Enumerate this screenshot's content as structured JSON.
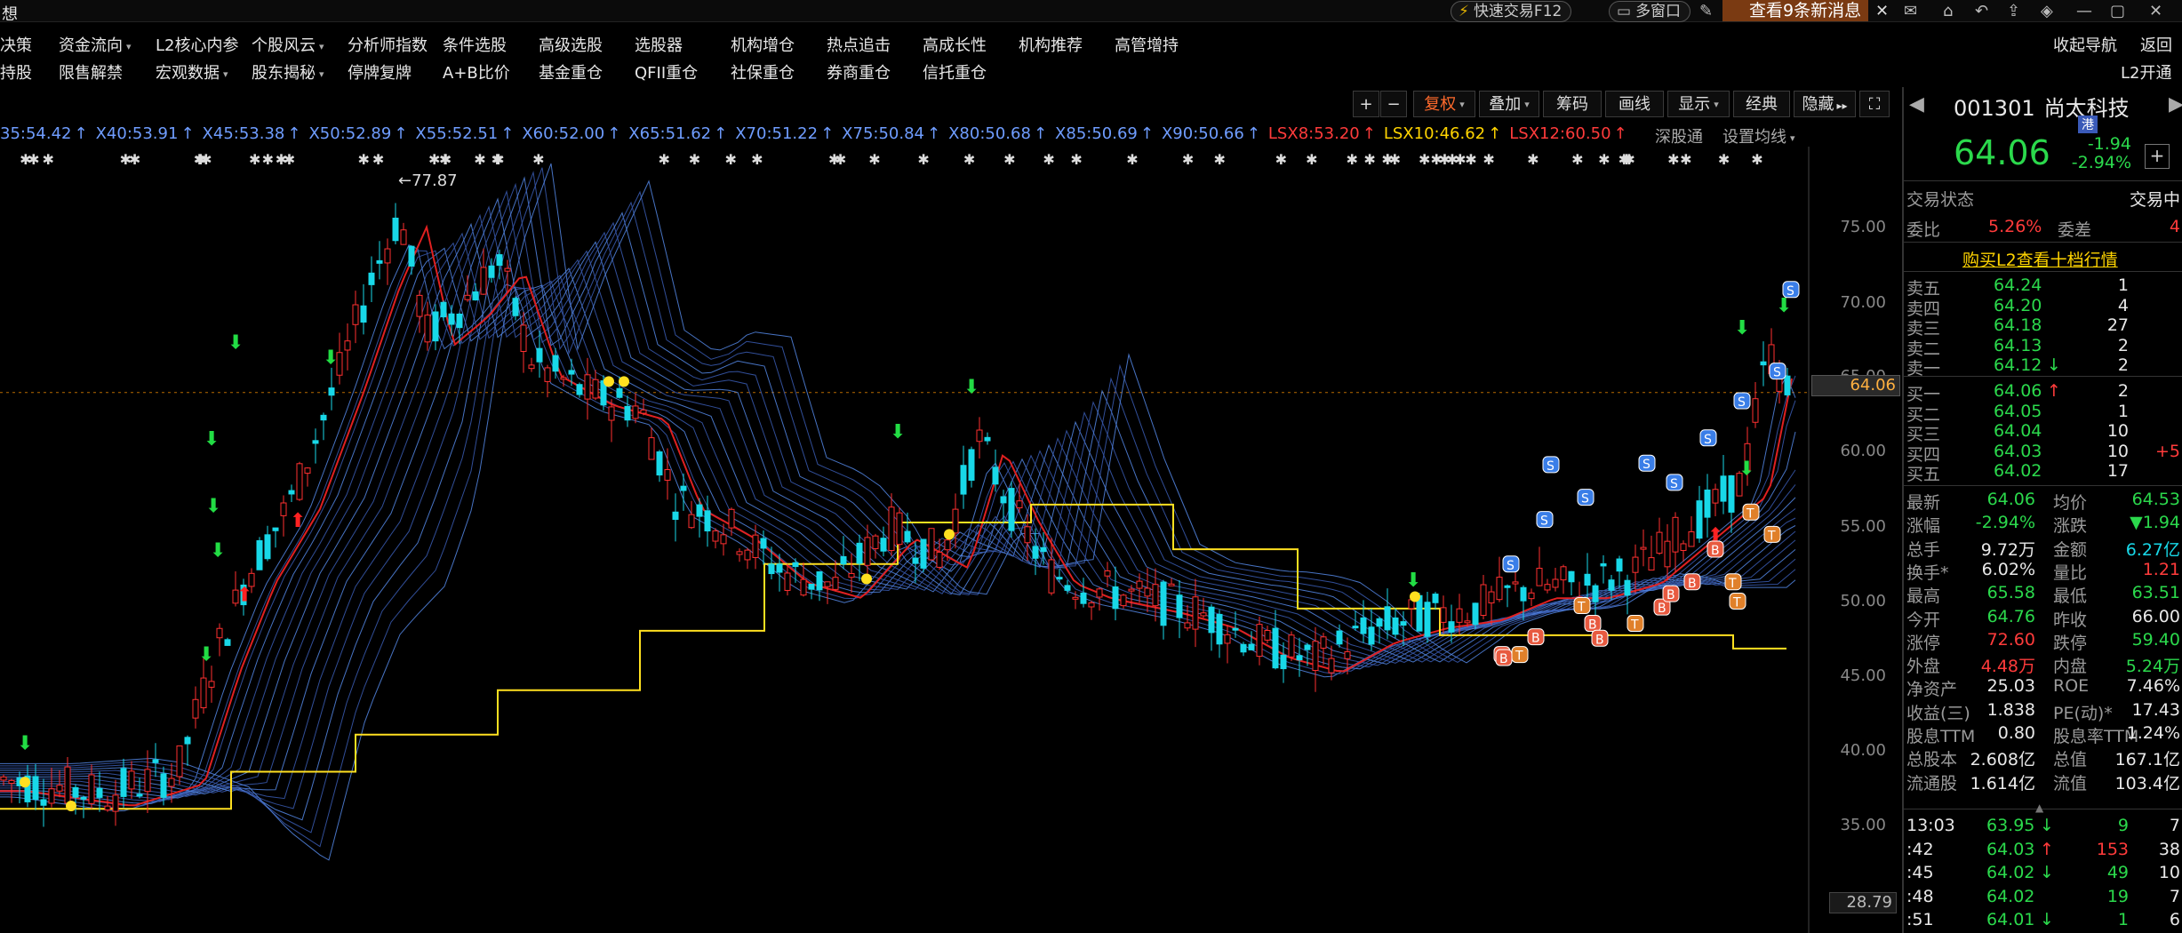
{
  "titlebar": {
    "app_name": "想",
    "quick_trade": "快速交易F12",
    "multi_window": "多窗口",
    "messages": "查看9条新消息"
  },
  "menu_row1": [
    "决策",
    "资金流向",
    "L2核心内参",
    "个股风云",
    "分析师指数",
    "条件选股",
    "高级选股",
    "选股器",
    "机构增仓",
    "热点追击",
    "高成长性",
    "机构推荐",
    "高管增持"
  ],
  "menu_row2": [
    "持股",
    "限售解禁",
    "宏观数据",
    "股东揭秘",
    "停牌复牌",
    "A+B比价",
    "基金重仓",
    "QFII重仓",
    "社保重仓",
    "券商重仓",
    "信托重仓"
  ],
  "right_top": {
    "nav": "收起导航",
    "back": "返回",
    "l2": "L2开通"
  },
  "toolbar": {
    "plus": "+",
    "minus": "−",
    "buttons": [
      "复权",
      "叠加",
      "筹码",
      "画线",
      "显示",
      "经典",
      "隐藏"
    ],
    "expand_icon": "expand"
  },
  "ma_legend": [
    {
      "text": "35:54.42",
      "color": "#6f9dff"
    },
    {
      "text": "X40:53.91",
      "color": "#6f9dff"
    },
    {
      "text": "X45:53.38",
      "color": "#6f9dff"
    },
    {
      "text": "X50:52.89",
      "color": "#6f9dff"
    },
    {
      "text": "X55:52.51",
      "color": "#6f9dff"
    },
    {
      "text": "X60:52.00",
      "color": "#6f9dff"
    },
    {
      "text": "X65:51.62",
      "color": "#6f9dff"
    },
    {
      "text": "X70:51.22",
      "color": "#6f9dff"
    },
    {
      "text": "X75:50.84",
      "color": "#6f9dff"
    },
    {
      "text": "X80:50.68",
      "color": "#6f9dff"
    },
    {
      "text": "X85:50.69",
      "color": "#6f9dff"
    },
    {
      "text": "X90:50.66",
      "color": "#6f9dff"
    },
    {
      "text": "LSX8:53.20",
      "color": "#ff3b3b"
    },
    {
      "text": "LSX10:46.62",
      "color": "#ffd400"
    },
    {
      "text": "LSX12:60.50",
      "color": "#ff3b3b"
    }
  ],
  "ma_buttons": {
    "depth": "深股通",
    "settings": "设置均线"
  },
  "chart_data": {
    "type": "candlestick",
    "y_ticks": [
      "75.00",
      "70.00",
      "65.00",
      "60.00",
      "55.00",
      "50.00",
      "45.00",
      "40.00",
      "35.00"
    ],
    "y_min_label": "28.79",
    "current_price_label": "64.06",
    "high_annotation": "←77.87",
    "ylim": [
      28.79,
      79.5
    ]
  },
  "quote": {
    "code": "001301",
    "name": "尚太科技",
    "hk_badge": "港",
    "price": "64.06",
    "change": "-1.94",
    "change_pct": "-2.94%",
    "status_label": "交易状态",
    "status_value": "交易中",
    "weibi_label": "委比",
    "weibi_value": "5.26%",
    "weicha_label": "委差",
    "weicha_value": "4",
    "l2_link": "购买L2查看十档行情"
  },
  "sells": [
    {
      "label": "卖五",
      "price": "64.24",
      "vol": "1",
      "arrow": ""
    },
    {
      "label": "卖四",
      "price": "64.20",
      "vol": "4",
      "arrow": ""
    },
    {
      "label": "卖三",
      "price": "64.18",
      "vol": "27",
      "arrow": ""
    },
    {
      "label": "卖二",
      "price": "64.13",
      "vol": "2",
      "arrow": ""
    },
    {
      "label": "卖一",
      "price": "64.12",
      "vol": "2",
      "arrow": "↓"
    }
  ],
  "buys": [
    {
      "label": "买一",
      "price": "64.06",
      "vol": "2",
      "arrow": "↑",
      "extra": ""
    },
    {
      "label": "买二",
      "price": "64.05",
      "vol": "1",
      "arrow": "",
      "extra": ""
    },
    {
      "label": "买三",
      "price": "64.04",
      "vol": "10",
      "arrow": "",
      "extra": ""
    },
    {
      "label": "买四",
      "price": "64.03",
      "vol": "10",
      "arrow": "",
      "extra": "+5"
    },
    {
      "label": "买五",
      "price": "64.02",
      "vol": "17",
      "arrow": "",
      "extra": ""
    }
  ],
  "stats": [
    {
      "l": "最新",
      "v": "64.06",
      "vc": "green",
      "l2": "均价",
      "v2": "64.53",
      "v2c": "green"
    },
    {
      "l": "涨幅",
      "v": "-2.94%",
      "vc": "green",
      "l2": "涨跌",
      "v2": "▼1.94",
      "v2c": "green"
    },
    {
      "l": "总手",
      "v": "9.72万",
      "vc": "white",
      "l2": "金额",
      "v2": "6.27亿",
      "v2c": "cyan"
    },
    {
      "l": "换手*",
      "v": "6.02%",
      "vc": "white",
      "l2": "量比",
      "v2": "1.21",
      "v2c": "red"
    },
    {
      "l": "最高",
      "v": "65.58",
      "vc": "green",
      "l2": "最低",
      "v2": "63.51",
      "v2c": "green"
    },
    {
      "l": "今开",
      "v": "64.76",
      "vc": "green",
      "l2": "昨收",
      "v2": "66.00",
      "v2c": "white"
    },
    {
      "l": "涨停",
      "v": "72.60",
      "vc": "red",
      "l2": "跌停",
      "v2": "59.40",
      "v2c": "green"
    },
    {
      "l": "外盘",
      "v": "4.48万",
      "vc": "red",
      "l2": "内盘",
      "v2": "5.24万",
      "v2c": "green"
    },
    {
      "l": "净资产",
      "v": "25.03",
      "vc": "white",
      "l2": "ROE",
      "v2": "7.46%",
      "v2c": "white"
    },
    {
      "l": "收益(三)",
      "v": "1.838",
      "vc": "white",
      "l2": "PE(动)*",
      "v2": "17.43",
      "v2c": "white"
    },
    {
      "l": "股息TTM",
      "v": "0.80",
      "vc": "white",
      "l2": "股息率TTM",
      "v2": "1.24%",
      "v2c": "white"
    },
    {
      "l": "总股本",
      "v": "2.608亿",
      "vc": "white",
      "l2": "总值",
      "v2": "167.1亿",
      "v2c": "white"
    },
    {
      "l": "流通股",
      "v": "1.614亿",
      "vc": "white",
      "l2": "流值",
      "v2": "103.4亿",
      "v2c": "white"
    }
  ],
  "ticks": [
    {
      "t": "13:03",
      "p": "63.95",
      "a": "↓",
      "pc": "green",
      "v": "9",
      "vc": "green",
      "n": "7"
    },
    {
      "t": ":42",
      "p": "64.03",
      "a": "↑",
      "pc": "green",
      "v": "153",
      "vc": "red",
      "n": "38"
    },
    {
      "t": ":45",
      "p": "64.02",
      "a": "↓",
      "pc": "green",
      "v": "49",
      "vc": "green",
      "n": "10"
    },
    {
      "t": ":48",
      "p": "64.02",
      "a": "",
      "pc": "green",
      "v": "19",
      "vc": "green",
      "n": "7"
    },
    {
      "t": ":51",
      "p": "64.01",
      "a": "↓",
      "pc": "green",
      "v": "1",
      "vc": "green",
      "n": "6"
    }
  ]
}
